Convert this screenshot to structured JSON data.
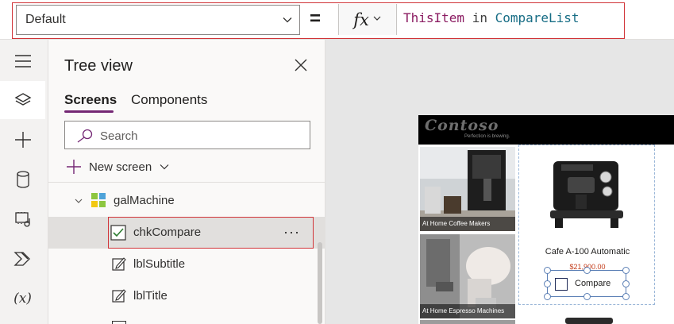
{
  "formula_bar": {
    "property_value": "Default",
    "equals": "=",
    "fx_label": "fx",
    "formula": {
      "token_item": "ThisItem",
      "token_in": " in ",
      "token_list": "CompareList"
    }
  },
  "rail": {
    "items": [
      {
        "icon": "hamburger-icon"
      },
      {
        "icon": "layers-icon"
      },
      {
        "icon": "plus-icon"
      },
      {
        "icon": "database-icon"
      },
      {
        "icon": "media-icon"
      },
      {
        "icon": "power-automate-icon"
      },
      {
        "icon": "variables-icon",
        "label": "(x)"
      }
    ]
  },
  "tree_view": {
    "title": "Tree view",
    "tabs": [
      {
        "label": "Screens",
        "active": true
      },
      {
        "label": "Components",
        "active": false
      }
    ],
    "search_placeholder": "Search",
    "new_screen_label": "New screen",
    "nodes": [
      {
        "label": "galMachine",
        "icon": "gallery-icon",
        "expanded": true
      },
      {
        "label": "chkCompare",
        "icon": "checkbox-icon",
        "selected": true,
        "more": "···"
      },
      {
        "label": "lblSubtitle",
        "icon": "label-icon"
      },
      {
        "label": "lblTitle",
        "icon": "label-icon"
      }
    ]
  },
  "canvas": {
    "logo": "Contoso",
    "tagline": "Perfection is brewing.",
    "categories": [
      {
        "caption": "At Home Coffee Makers"
      },
      {
        "caption": "At Home Espresso Machines"
      }
    ],
    "product": {
      "name": "Cafe A-100 Automatic",
      "price": "$21,900.00",
      "checkbox_label": "Compare"
    }
  },
  "colors": {
    "accent": "#742774",
    "highlight_border": "#d13438",
    "token_item": "#8b1c62",
    "token_ref": "#176d85"
  }
}
